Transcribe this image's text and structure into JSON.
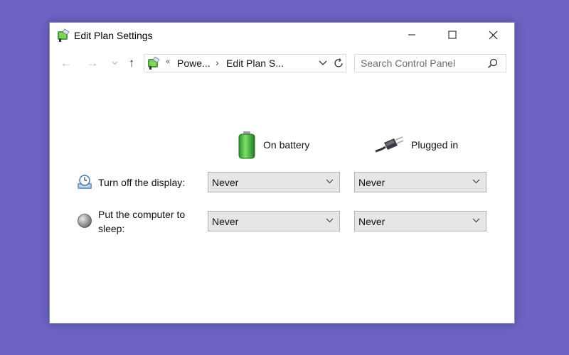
{
  "window": {
    "title": "Edit Plan Settings"
  },
  "address": {
    "prefix": "«",
    "crumbs": [
      "Powe...",
      "Edit Plan S..."
    ],
    "separator": "›"
  },
  "search": {
    "placeholder": "Search Control Panel"
  },
  "columns": {
    "battery": "On battery",
    "plugged": "Plugged in"
  },
  "rows": [
    {
      "label": "Turn off the display:",
      "battery_value": "Never",
      "plugged_value": "Never"
    },
    {
      "label_line1": "Put the computer to",
      "label_line2": "sleep:",
      "battery_value": "Never",
      "plugged_value": "Never"
    }
  ],
  "colors": {
    "desktop": "#6c63c4",
    "window_bg": "#ffffff",
    "dropdown_bg": "#e6e6e6",
    "battery_green": "#3fb63f"
  },
  "icons": {
    "title": "power-options-icon",
    "battery": "battery-icon",
    "plug": "power-plug-icon",
    "display": "display-timer-icon",
    "sleep": "sleep-moon-icon"
  }
}
